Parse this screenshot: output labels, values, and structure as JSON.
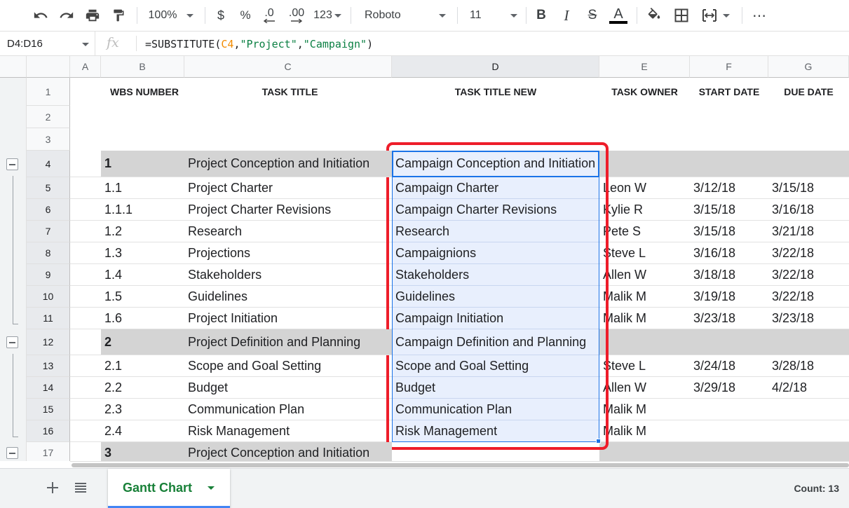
{
  "toolbar": {
    "zoom": "100%",
    "currency": "$",
    "percent": "%",
    "dec_less": ".0",
    "dec_more": ".00",
    "more_formats": "123",
    "font": "Roboto",
    "font_size": "11",
    "bold": "B",
    "italic": "I",
    "strike": "S",
    "text_color": "A",
    "more": "⋯"
  },
  "formula_bar": {
    "name_box": "D4:D16",
    "fx": "fx",
    "formula_prefix": "=SUBSTITUTE(",
    "formula_ref": "C4",
    "formula_comma1": ",",
    "formula_arg2": "\"Project\"",
    "formula_comma2": ",",
    "formula_arg3": "\"Campaign\"",
    "formula_suffix": ")"
  },
  "columns": [
    "A",
    "B",
    "C",
    "D",
    "E",
    "F",
    "G"
  ],
  "headers": {
    "b": "WBS NUMBER",
    "c": "TASK TITLE",
    "d": "TASK TITLE NEW",
    "e": "TASK OWNER",
    "f": "START DATE",
    "g": "DUE DATE"
  },
  "rows": [
    {
      "num": "1"
    },
    {
      "num": "2"
    },
    {
      "num": "3"
    },
    {
      "num": "4",
      "b": "1",
      "c": "Project Conception and Initiation",
      "d": "Campaign Conception and Initiation",
      "e": "",
      "f": "",
      "g": ""
    },
    {
      "num": "5",
      "b": "1.1",
      "c": "Project Charter",
      "d": "Campaign Charter",
      "e": "Leon W",
      "f": "3/12/18",
      "g": "3/15/18"
    },
    {
      "num": "6",
      "b": "1.1.1",
      "c": "Project Charter Revisions",
      "d": "Campaign Charter Revisions",
      "e": "Kylie R",
      "f": "3/15/18",
      "g": "3/16/18"
    },
    {
      "num": "7",
      "b": "1.2",
      "c": "Research",
      "d": "Research",
      "e": "Pete S",
      "f": "3/15/18",
      "g": "3/21/18"
    },
    {
      "num": "8",
      "b": "1.3",
      "c": "Projections",
      "d": "Campaignions",
      "e": "Steve L",
      "f": "3/16/18",
      "g": "3/22/18"
    },
    {
      "num": "9",
      "b": "1.4",
      "c": "Stakeholders",
      "d": "Stakeholders",
      "e": "Allen W",
      "f": "3/18/18",
      "g": "3/22/18"
    },
    {
      "num": "10",
      "b": "1.5",
      "c": "Guidelines",
      "d": "Guidelines",
      "e": "Malik M",
      "f": "3/19/18",
      "g": "3/22/18"
    },
    {
      "num": "11",
      "b": "1.6",
      "c": "Project Initiation",
      "d": "Campaign Initiation",
      "e": "Malik M",
      "f": "3/23/18",
      "g": "3/23/18"
    },
    {
      "num": "12",
      "b": "2",
      "c": "Project Definition and Planning",
      "d": "Campaign Definition and Planning",
      "e": "",
      "f": "",
      "g": ""
    },
    {
      "num": "13",
      "b": "2.1",
      "c": "Scope and Goal Setting",
      "d": "Scope and Goal Setting",
      "e": "Steve L",
      "f": "3/24/18",
      "g": "3/28/18"
    },
    {
      "num": "14",
      "b": "2.2",
      "c": "Budget",
      "d": "Budget",
      "e": "Allen W",
      "f": "3/29/18",
      "g": "4/2/18"
    },
    {
      "num": "15",
      "b": "2.3",
      "c": "Communication Plan",
      "d": "Communication Plan",
      "e": "Malik M",
      "f": "",
      "g": ""
    },
    {
      "num": "16",
      "b": "2.4",
      "c": "Risk Management",
      "d": "Risk Management",
      "e": "Malik M",
      "f": "",
      "g": ""
    },
    {
      "num": "17",
      "b": "3",
      "c": "Project Conception and Initiation",
      "d": "",
      "e": "",
      "f": "",
      "g": ""
    }
  ],
  "sheet_tabs": [
    {
      "label": "Gantt Chart"
    }
  ],
  "status": {
    "count": "Count: 13"
  },
  "colors": {
    "accent_blue": "#1a73e8",
    "highlight_red": "#ee1d2a",
    "tab_green": "#188038",
    "section_grey": "#d4d4d4",
    "selection_fill": "#e8effd"
  }
}
